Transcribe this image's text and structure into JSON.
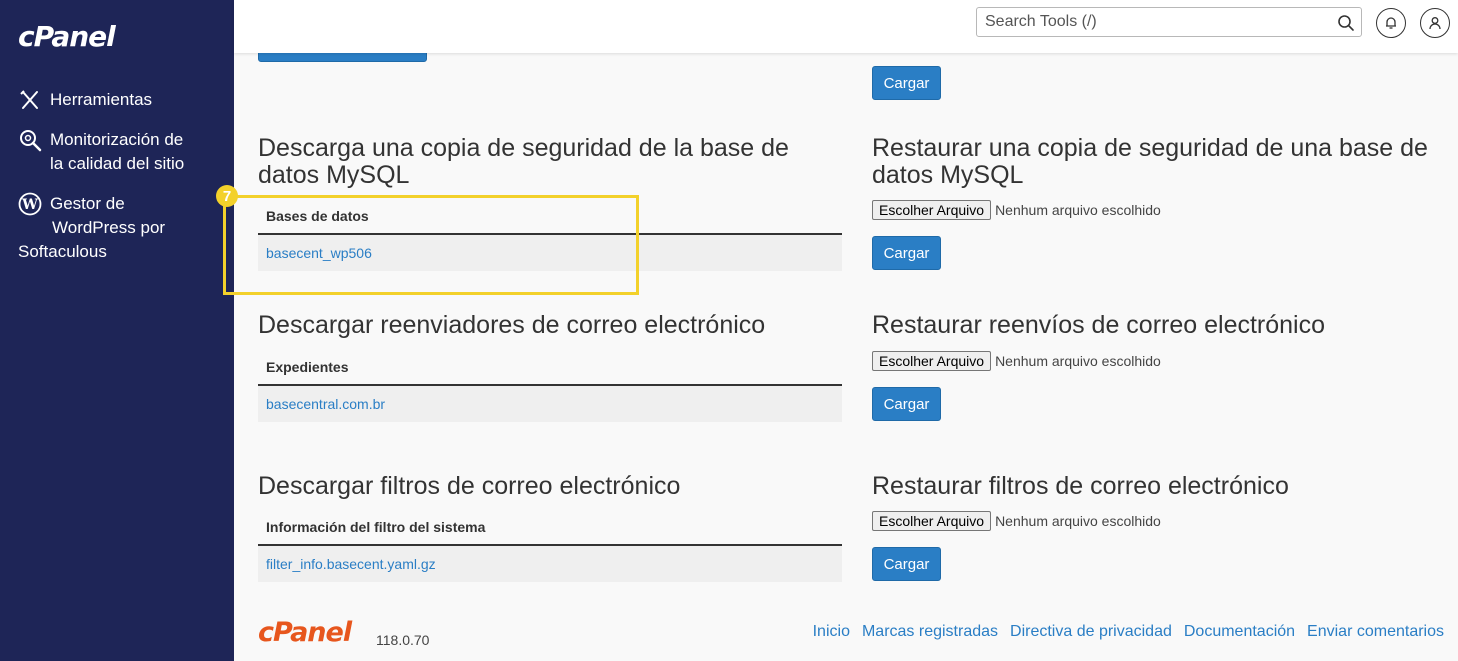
{
  "sidebar": {
    "logo": "cPanel",
    "items": [
      {
        "label": "Herramientas"
      },
      {
        "label_line1": "Monitorización de",
        "label_line2": "la calidad del sitio"
      },
      {
        "label_line1": "Gestor de",
        "label_line2": "WordPress por",
        "label_line3": "Softaculous"
      }
    ]
  },
  "header": {
    "search_placeholder": "Search Tools (/)"
  },
  "top_right": {
    "cargar_label": "Cargar"
  },
  "sections": {
    "mysql_download": {
      "title": "Descarga una copia de seguridad de la base de datos MySQL",
      "column": "Bases de datos",
      "rows": [
        "basecent_wp506"
      ]
    },
    "mysql_restore": {
      "title": "Restaurar una copia de seguridad de una base de datos MySQL",
      "file_button": "Escolher Arquivo",
      "file_status": "Nenhum arquivo escolhido",
      "cargar_label": "Cargar"
    },
    "forwarders_download": {
      "title": "Descargar reenviadores de correo electrónico",
      "column": "Expedientes",
      "rows": [
        "basecentral.com.br"
      ]
    },
    "forwarders_restore": {
      "title": "Restaurar reenvíos de correo electrónico",
      "file_button": "Escolher Arquivo",
      "file_status": "Nenhum arquivo escolhido",
      "cargar_label": "Cargar"
    },
    "filters_download": {
      "title": "Descargar filtros de correo electrónico",
      "column": "Información del filtro del sistema",
      "rows": [
        "filter_info.basecent.yaml.gz"
      ]
    },
    "filters_restore": {
      "title": "Restaurar filtros de correo electrónico",
      "file_button": "Escolher Arquivo",
      "file_status": "Nenhum arquivo escolhido",
      "cargar_label": "Cargar"
    }
  },
  "annotation": {
    "step_number": "7",
    "color": "#f3d12b"
  },
  "footer": {
    "logo": "cPanel",
    "version": "118.0.70",
    "links": [
      "Inicio",
      "Marcas registradas",
      "Directiva de privacidad",
      "Documentación",
      "Enviar comentarios"
    ]
  },
  "colors": {
    "sidebar_bg": "#1e2557",
    "accent": "#2a7ec5",
    "logo_orange": "#e7561d"
  }
}
